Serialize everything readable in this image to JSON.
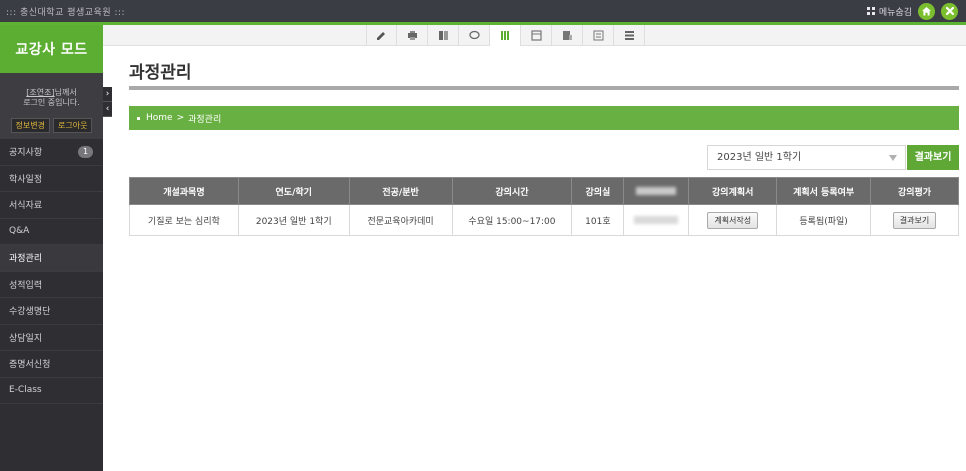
{
  "topbar": {
    "site_name": "::: 충신대학교 평생교육원 :::",
    "menu_toggle_label": "메뉴숨김"
  },
  "sidebar": {
    "mode_title": "교강사 모드",
    "user_name": "[조연조]",
    "user_suffix": "님께서",
    "login_status": "로그인 중입니다.",
    "edit_info_label": "정보변경",
    "logout_label": "로그아웃",
    "items": [
      {
        "label": "공지사항",
        "badge": "1"
      },
      {
        "label": "학사일정"
      },
      {
        "label": "서식자료"
      },
      {
        "label": "Q&A"
      },
      {
        "label": "과정관리",
        "active": true
      },
      {
        "label": "성적입력"
      },
      {
        "label": "수강생명단"
      },
      {
        "label": "상담일지"
      },
      {
        "label": "증명서신청"
      },
      {
        "label": "E-Class"
      }
    ]
  },
  "toolbar_icons": [
    "pencil-icon",
    "printer-icon",
    "document-icon",
    "chat-icon",
    "book-icon",
    "calendar-icon",
    "notepad-icon",
    "list-icon",
    "stack-icon"
  ],
  "page": {
    "title": "과정관리",
    "breadcrumb_home": "Home",
    "breadcrumb_sep": ">",
    "breadcrumb_current": "과정관리"
  },
  "filter": {
    "selected_term": "2023년 일반 1학기",
    "result_button": "결과보기"
  },
  "table": {
    "headers": [
      "개설과목명",
      "연도/학기",
      "전공/분반",
      "강의시간",
      "강의실",
      "",
      "강의계획서",
      "계획서 등록여부",
      "강의평가"
    ],
    "rows": [
      {
        "course": "기질로 보는 심리학",
        "term": "2023년 일반 1학기",
        "major": "전문교육아카데미",
        "time": "수요일 15:00~17:00",
        "room": "101호",
        "plan_button": "계획서작성",
        "plan_status": "등록됨(파일)",
        "eval_button": "결과보기"
      }
    ]
  },
  "colors": {
    "accent_green": "#5cae32",
    "sidebar_bg": "#2f2f33",
    "header_gray": "#6a6a6a"
  }
}
